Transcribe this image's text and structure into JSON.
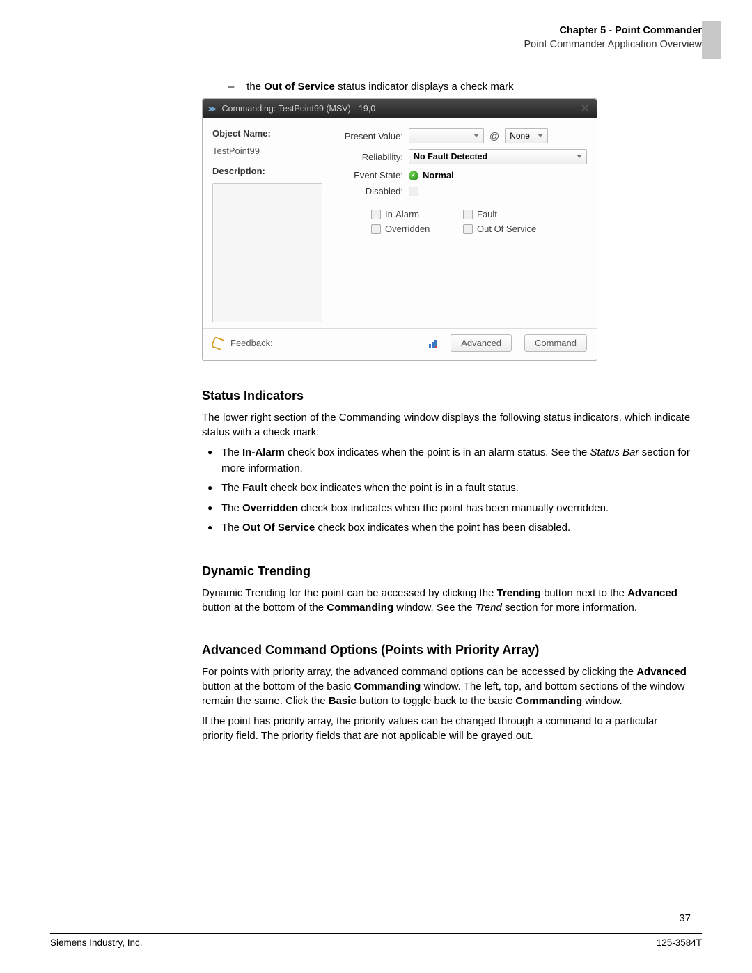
{
  "header": {
    "chapter": "Chapter 5 - Point Commander",
    "subtitle": "Point Commander Application Overview"
  },
  "intro_bullet": {
    "prefix": "the ",
    "bold": "Out of Service",
    "suffix": " status indicator displays a check mark"
  },
  "window": {
    "title": "Commanding: TestPoint99 (MSV) - 19,0",
    "left": {
      "object_name_label": "Object Name:",
      "object_name_value": "TestPoint99",
      "description_label": "Description:"
    },
    "right": {
      "present_value_label": "Present Value:",
      "priority_value": "None",
      "reliability_label": "Reliability:",
      "reliability_value": "No Fault Detected",
      "event_state_label": "Event State:",
      "event_state_value": "Normal",
      "disabled_label": "Disabled:"
    },
    "status": {
      "in_alarm": "In-Alarm",
      "fault": "Fault",
      "overridden": "Overridden",
      "out_of_service": "Out Of Service"
    },
    "footer": {
      "feedback": "Feedback:",
      "advanced": "Advanced",
      "command": "Command"
    }
  },
  "sections": {
    "status": {
      "title": "Status Indicators",
      "intro": "The lower right section of the Commanding window displays the following status indicators, which indicate status with a check mark:",
      "b1_a": "The ",
      "b1_b": "In-Alarm",
      "b1_c": " check box indicates when the point is in an alarm status. See the ",
      "b1_d": "Status Bar",
      "b1_e": " section for more information.",
      "b2_a": "The ",
      "b2_b": "Fault",
      "b2_c": " check box indicates when the point is in a fault status.",
      "b3_a": "The ",
      "b3_b": "Overridden",
      "b3_c": " check box indicates when the point has been manually overridden.",
      "b4_a": "The ",
      "b4_b": "Out Of Service",
      "b4_c": " check box indicates when the point has been disabled."
    },
    "trending": {
      "title": "Dynamic Trending",
      "p_a": "Dynamic Trending for the point can be accessed by clicking the ",
      "p_b": "Trending",
      "p_c": " button next to the ",
      "p_d": "Advanced",
      "p_e": " button at the bottom of the ",
      "p_f": "Commanding",
      "p_g": " window. See the ",
      "p_h": "Trend",
      "p_i": " section for more information."
    },
    "advanced": {
      "title": "Advanced Command Options (Points with Priority Array)",
      "p1_a": "For points with priority array, the advanced command options can be accessed by clicking the ",
      "p1_b": "Advanced",
      "p1_c": " button at the bottom of the basic ",
      "p1_d": "Commanding",
      "p1_e": " window. The left, top, and bottom sections of the window remain the same. Click the ",
      "p1_f": "Basic",
      "p1_g": " button to toggle back to the basic ",
      "p1_h": "Commanding",
      "p1_i": " window.",
      "p2": "If the point has priority array, the priority values can be changed through a command to a particular priority field. The priority fields that are not applicable will be grayed out."
    }
  },
  "footer": {
    "page": "37",
    "left": "Siemens Industry, Inc.",
    "right": "125-3584T"
  }
}
